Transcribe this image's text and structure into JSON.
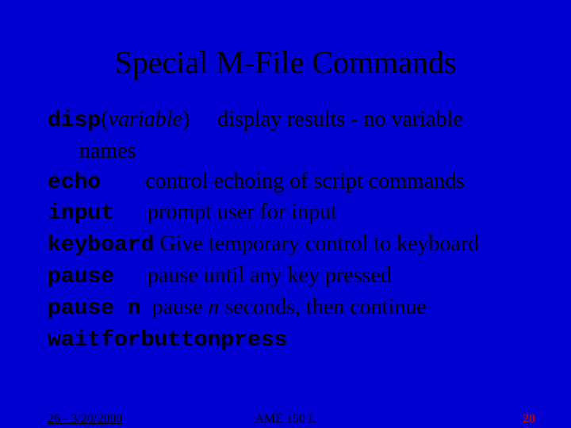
{
  "title": "Special M-File Commands",
  "cmd": {
    "disp": "disp",
    "disp_arg_open": "(",
    "disp_arg": "variable",
    "disp_arg_close": ")",
    "disp_desc1": "display results - no variable",
    "disp_desc2": "names",
    "echo": "echo",
    "echo_desc": "control echoing of script commands",
    "input": "input",
    "input_desc": "prompt user for input",
    "keyboard": "keyboard",
    "keyboard_desc": "Give temporary control to keyboard",
    "pause": "pause",
    "pause_desc": "pause until any key pressed",
    "pausen": "pause n",
    "pausen_desc_a": "pause ",
    "pausen_desc_n": "n",
    "pausen_desc_b": " seconds, then continue",
    "wait": "waitforbuttonpress"
  },
  "footer": {
    "left": "26 - 3/20/2000",
    "center": "AME 150 L",
    "right": "20"
  }
}
